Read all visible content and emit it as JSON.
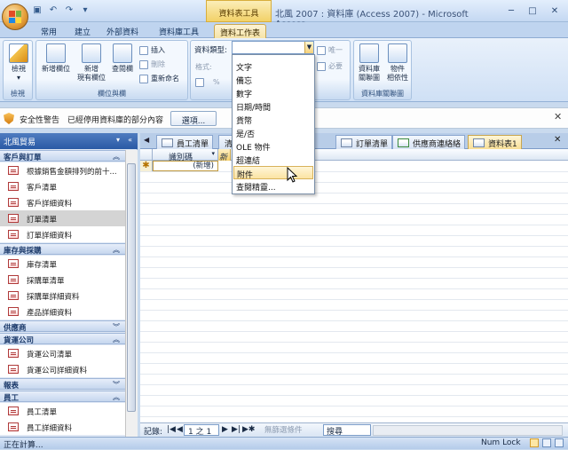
{
  "window": {
    "title": "北風 2007 : 資料庫 (Access 2007) - Microsoft Access",
    "context_tab_group": "資料表工具",
    "controls": [
      "─",
      "□",
      "✕"
    ]
  },
  "ribbon_tabs": [
    "常用",
    "建立",
    "外部資料",
    "資料庫工具",
    "資料工作表"
  ],
  "ribbon": {
    "views": {
      "button": "檢視",
      "group_label": "檢視"
    },
    "fields_columns": {
      "new_field": "新增欄位",
      "add_existing_fields": [
        "新增",
        "現有欄位"
      ],
      "lookup_column": "查閱欄",
      "insert": "插入",
      "delete": "刪除",
      "rename": "重新命名",
      "group_label": "欄位與欄"
    },
    "data_type_formatting": {
      "data_type_label": "資料類型:",
      "format_label": "格式:",
      "unique_label": "唯一",
      "required_label": "必要",
      "percent_symbol": "%"
    },
    "relationships": {
      "relationships": [
        "資料庫",
        "關聯圖"
      ],
      "object_dependencies": [
        "物件",
        "相依性"
      ],
      "group_label": "資料庫關聯圖"
    }
  },
  "data_type_dropdown": {
    "options": [
      "文字",
      "備忘",
      "數字",
      "日期/時間",
      "貨幣",
      "是/否",
      "OLE 物件",
      "超連結",
      "附件",
      "查閱精靈..."
    ],
    "hovered": "附件"
  },
  "security_bar": {
    "title": "安全性警告",
    "message": "已經停用資料庫的部分內容",
    "options_button": "選項...",
    "close": "✕"
  },
  "nav_pane": {
    "title": "北風貿易",
    "groups": [
      {
        "label": "客戶與訂單",
        "expanded": true,
        "items": [
          "根據銷售金額排列的前十...",
          "客戶清單",
          "客戶詳細資料",
          "訂單清單",
          "訂單詳細資料"
        ],
        "selected": "訂單清單"
      },
      {
        "label": "庫存與採購",
        "expanded": true,
        "items": [
          "庫存清單",
          "採購單清單",
          "採購單詳細資料",
          "產品詳細資料"
        ]
      },
      {
        "label": "供應商",
        "expanded": false,
        "items": []
      },
      {
        "label": "貨運公司",
        "expanded": true,
        "items": [
          "貨運公司清單",
          "貨運公司詳細資料"
        ]
      },
      {
        "label": "報表",
        "expanded": false,
        "items": []
      },
      {
        "label": "員工",
        "expanded": true,
        "items": [
          "員工清單",
          "員工詳細資料"
        ]
      }
    ]
  },
  "doc_tabs": {
    "tabs": [
      "員工清單",
      "清單",
      "訂單清單",
      "供應商連絡絡",
      "資料表1"
    ],
    "active": "資料表1"
  },
  "datasheet": {
    "columns": [
      "識別碼",
      "新增"
    ],
    "new_record_marker": "✱",
    "new_record_value": "(新增)"
  },
  "record_nav": {
    "label": "記錄:",
    "position": "1 之 1",
    "filter": "無篩選條件",
    "search_placeholder": "搜尋"
  },
  "status_bar": {
    "left": "正在計算...",
    "right": "Num Lock"
  },
  "colors": {
    "accent": "#2a5aa5",
    "highlight": "#f8de96",
    "ribbon": "#cfe0f5"
  }
}
